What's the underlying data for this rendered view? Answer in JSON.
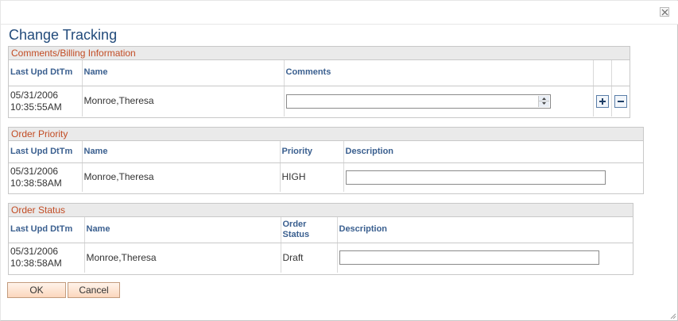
{
  "dialog": {
    "title": "Change Tracking"
  },
  "comments_section": {
    "title": "Comments/Billing Information",
    "headers": {
      "dt": "Last Upd DtTm",
      "name": "Name",
      "comments": "Comments"
    },
    "row": {
      "date": "05/31/2006",
      "time": "10:35:55AM",
      "name": "Monroe,Theresa",
      "comments_value": ""
    }
  },
  "priority_section": {
    "title": "Order Priority",
    "headers": {
      "dt": "Last Upd DtTm",
      "name": "Name",
      "priority": "Priority",
      "description": "Description"
    },
    "row": {
      "date": "05/31/2006",
      "time": "10:38:58AM",
      "name": "Monroe,Theresa",
      "priority": "HIGH",
      "description_value": ""
    }
  },
  "status_section": {
    "title": "Order Status",
    "headers": {
      "dt": "Last Upd DtTm",
      "name": "Name",
      "status_line1": "Order",
      "status_line2": "Status",
      "description": "Description"
    },
    "row": {
      "date": "05/31/2006",
      "time": "10:38:58AM",
      "name": "Monroe,Theresa",
      "status": "Draft",
      "description_value": ""
    }
  },
  "buttons": {
    "ok": "OK",
    "cancel": "Cancel"
  },
  "icons": {
    "close": "close-icon",
    "add": "plus-icon",
    "delete": "minus-icon",
    "resize": "resize-grip-icon"
  },
  "colors": {
    "title": "#224b7b",
    "section_title": "#c24c24",
    "header_text": "#3a5f8f",
    "button_bg": "#fbd7bd"
  }
}
